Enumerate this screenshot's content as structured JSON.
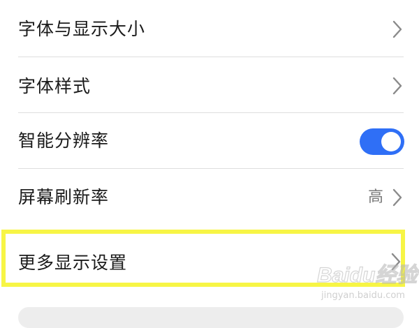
{
  "settings": {
    "items": [
      {
        "label": "字体与显示大小",
        "control": "chevron"
      },
      {
        "label": "字体样式",
        "control": "chevron"
      },
      {
        "label": "智能分辨率",
        "control": "toggle",
        "toggle_on": true
      },
      {
        "label": "屏幕刷新率",
        "control": "chevron",
        "value": "高"
      },
      {
        "label": "更多显示设置",
        "control": "chevron",
        "highlighted": true
      }
    ]
  },
  "icons": {
    "chevron": "chevron-right-icon"
  },
  "colors": {
    "toggle_on": "#2f6ff6",
    "highlight_border": "#f7f545",
    "divider": "#dedede",
    "text_primary": "#1a1a1a",
    "text_secondary": "#7a7a7a",
    "chevron": "#8a8a8a"
  },
  "watermark": {
    "brand": "Baidu经验",
    "url": "jingyan.baidu.com"
  }
}
